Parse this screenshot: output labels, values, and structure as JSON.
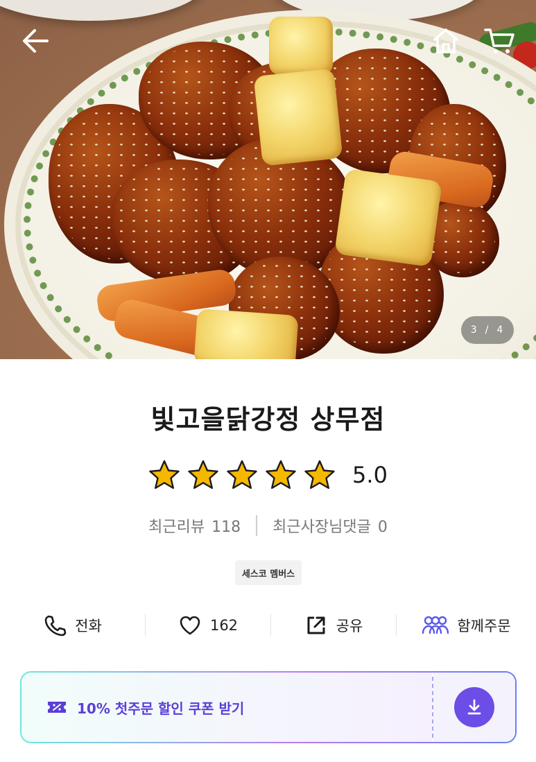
{
  "hero": {
    "image_description_icon": "fried-chicken-photo",
    "page_current": "3",
    "page_separator": "/",
    "page_total": "4"
  },
  "nav": {
    "back_icon": "back-arrow-icon",
    "home_icon": "home-icon",
    "cart_icon": "cart-icon"
  },
  "store": {
    "name": "빛고을닭강정 상무점",
    "rating": "5.0",
    "rating_stars": 5,
    "recent_review_label": "최근리뷰",
    "recent_review_count": "118",
    "owner_reply_label": "최근사장님댓글",
    "owner_reply_count": "0",
    "badge": "세스코 멤버스"
  },
  "actions": [
    {
      "icon": "phone-icon",
      "label": "전화"
    },
    {
      "icon": "heart-icon",
      "label": "162"
    },
    {
      "icon": "share-icon",
      "label": "공유"
    },
    {
      "icon": "group-order-icon",
      "label": "함께주문"
    }
  ],
  "coupon": {
    "text": "10% 첫주문 할인 쿠폰 받기",
    "icon": "coupon-ticket-icon",
    "download_icon": "download-icon"
  },
  "colors": {
    "accent": "#6c4de6",
    "coupon_text": "#5a3fd6",
    "star": "#f5b700",
    "group_icon": "#5a57e6"
  }
}
